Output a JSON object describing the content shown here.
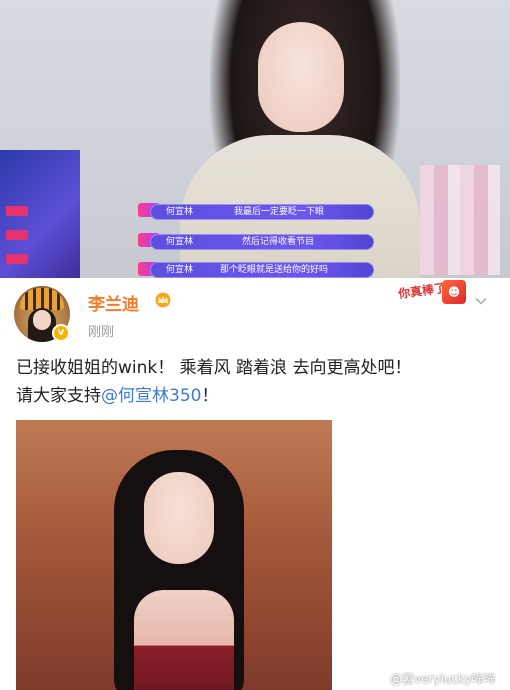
{
  "video": {
    "speaker": "何宣林",
    "subtitles": [
      "我最后一定要眨一下眼",
      "然后记得收看节目",
      "那个眨眼就是送给你的好吗"
    ]
  },
  "post": {
    "author": "李兰迪",
    "time": "刚刚",
    "text_line1": "已接收姐姐的wink！ 乘着风 踏着浪 去向更高处吧！",
    "text_line2_prefix": "请大家支持",
    "mention": "@何宣林350",
    "text_line2_suffix": "！",
    "sticker_text": "你真棒了"
  },
  "watermark": "@紊verylucky哞哞",
  "colors": {
    "name": "#f07c2d",
    "mention": "#3a7bd5",
    "subtitle_bar": "#5b4fe0",
    "verify": "#f7b500"
  }
}
